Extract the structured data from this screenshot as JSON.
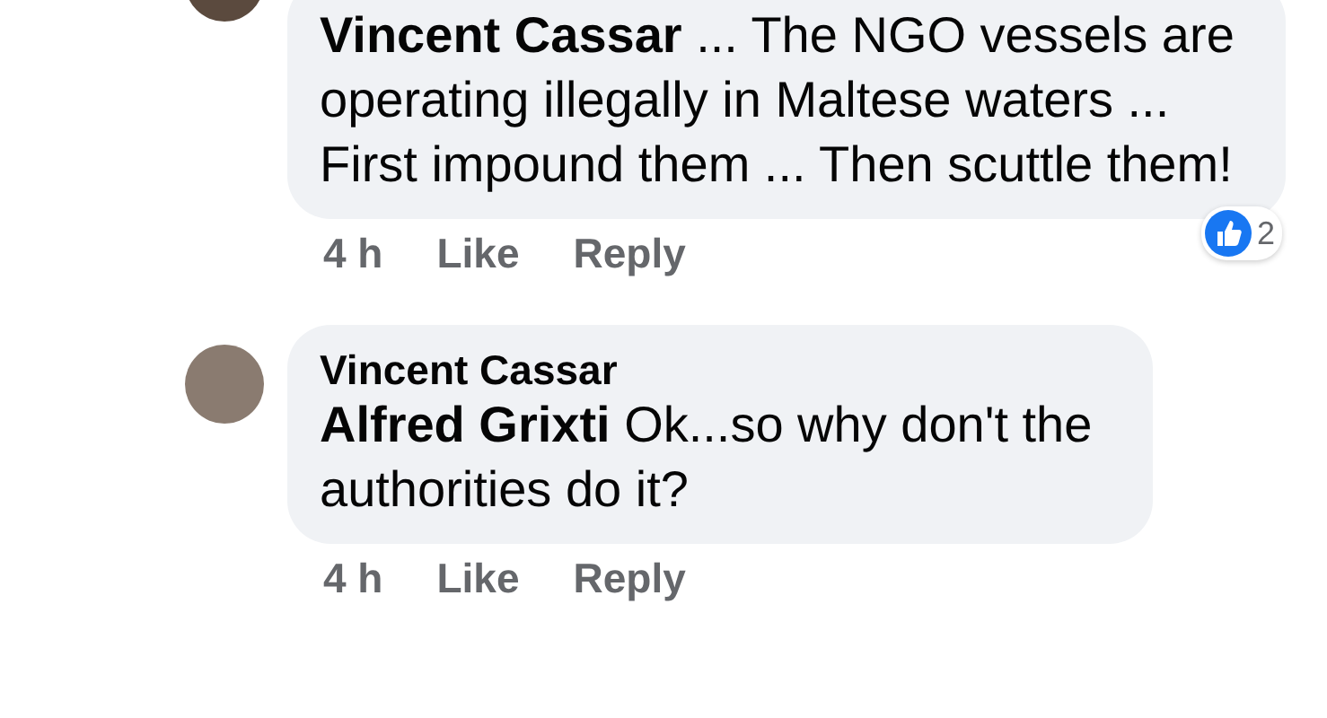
{
  "comments": [
    {
      "text": "**Vincent Cassar** ... The NGO vessels are operating illegally in Maltese waters ... First impound them ... Then scuttle them!",
      "reaction_count": "2",
      "actions": [
        "4 h",
        "Like",
        "Reply"
      ]
    },
    {
      "author": "Vincent Cassar",
      "text": "**Alfred Grixti** Ok...so why don't the authorities do it?",
      "actions": [
        "4 h",
        "Like",
        "Reply"
      ]
    }
  ]
}
